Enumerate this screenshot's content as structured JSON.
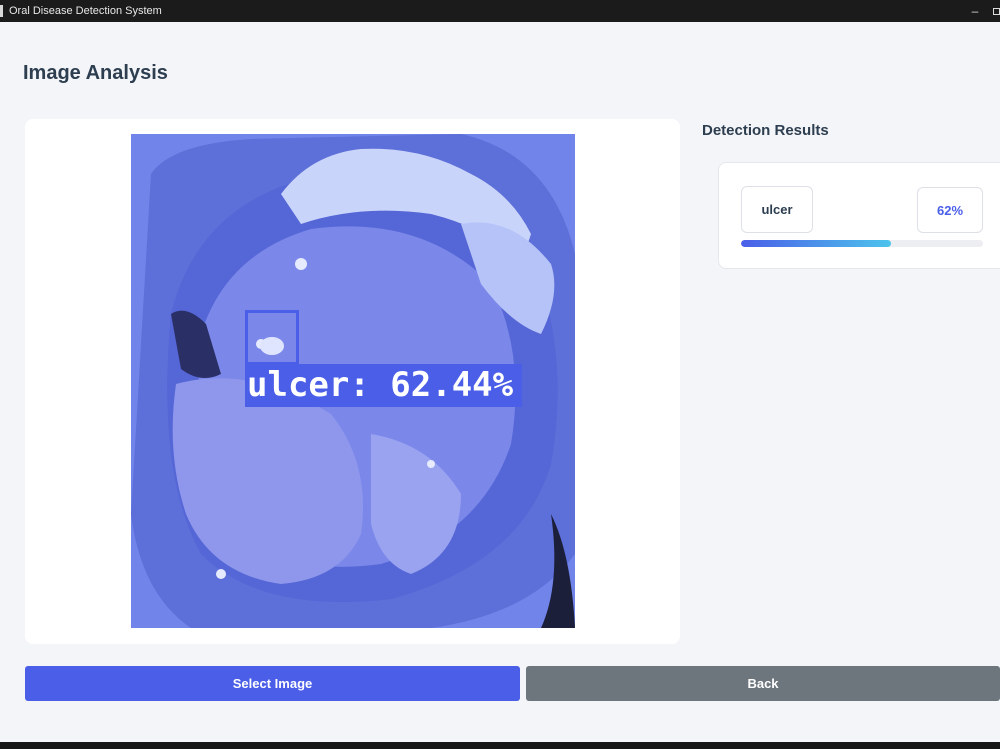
{
  "window": {
    "title": "Oral Disease Detection System",
    "minimize_glyph": "–"
  },
  "page": {
    "title": "Image Analysis"
  },
  "image": {
    "detection_label": "ulcer: 62.44%",
    "tint_color": "#5f6fe6",
    "box_color": "#4a5ee8"
  },
  "results": {
    "title": "Detection Results",
    "items": [
      {
        "label": "ulcer",
        "percent_text": "62%",
        "confidence": 0.62
      }
    ]
  },
  "buttons": {
    "select_label": "Select Image",
    "back_label": "Back"
  },
  "colors": {
    "accent": "#4a5ee8",
    "secondary": "#6d757d",
    "progress_end": "#4cc4ec"
  }
}
